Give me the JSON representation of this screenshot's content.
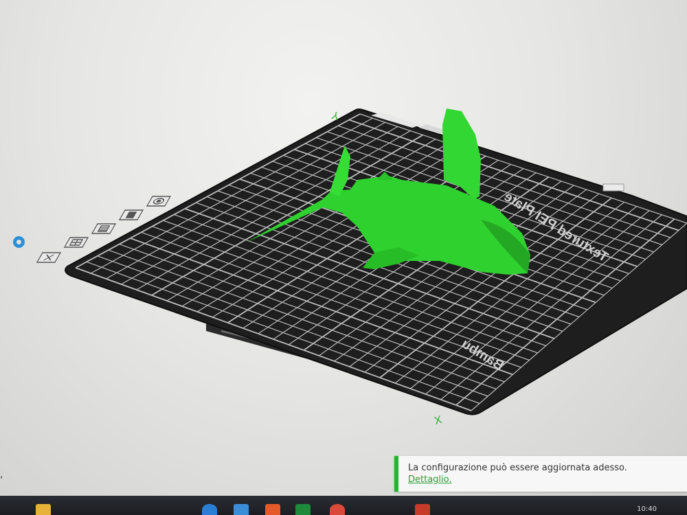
{
  "viewport": {
    "bed_label": "Textured PEI Plate",
    "bed_brand": "Bambu"
  },
  "model": {
    "name": "shark",
    "color": "#2fd12f"
  },
  "axes": {
    "y_label": "Y",
    "x_label": "X"
  },
  "toolbar": {
    "icons": [
      "display-icon",
      "assembly-icon",
      "cube-face-icon",
      "box-icon",
      "grid-icon",
      "close-icon"
    ]
  },
  "notification": {
    "message": "La configurazione può essere aggiornata adesso.",
    "link": "Dettaglio."
  },
  "taskbar": {
    "clock": "10:40",
    "apps": [
      "file-explorer-icon",
      "edge-icon",
      "store-icon",
      "office-icon",
      "excel-icon",
      "chrome-icon",
      "app-icon"
    ]
  },
  "colors": {
    "accent": "#2b8fd6",
    "success": "#1fb82c",
    "bed": "#1e1e1e",
    "grid": "#bdbdbd"
  }
}
